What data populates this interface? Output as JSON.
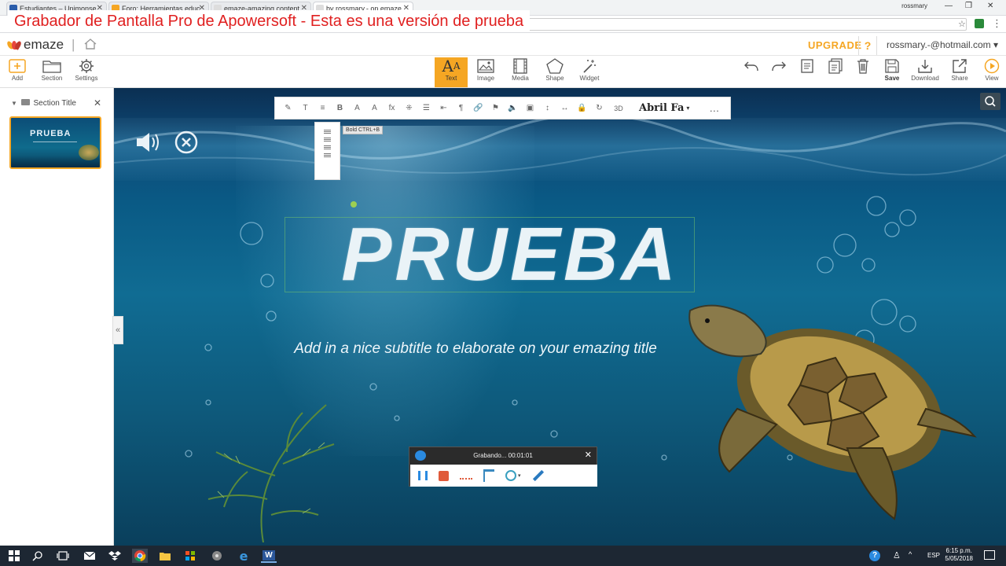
{
  "browser": {
    "tabs": [
      {
        "label": "Estudiantes – Unimonse",
        "favicon_color": "#2a5caa"
      },
      {
        "label": "Foro: Herramientas educ",
        "favicon_color": "#f5a623"
      },
      {
        "label": "emaze-amazing content",
        "favicon_color": "#dddddd"
      },
      {
        "label": "by rossmary.- on emaze",
        "favicon_color": "#dddddd"
      }
    ],
    "user_chip": "rossmary",
    "watermark": "Grabador de Pantalla Pro de Apowersoft - Esta es una versión de prueba"
  },
  "app": {
    "logo_text": "emaze",
    "upgrade_label": "UPGRADE",
    "help_label": "?",
    "account": "rossmary.-@hotmail.com ▾"
  },
  "toolbar": {
    "left": [
      {
        "label": "Add",
        "icon": "plus-box-icon"
      },
      {
        "label": "Section",
        "icon": "folder-icon"
      },
      {
        "label": "Settings",
        "icon": "gear-icon"
      }
    ],
    "center": [
      {
        "label": "Text",
        "icon": "text-aa-icon",
        "active": true
      },
      {
        "label": "Image",
        "icon": "image-icon"
      },
      {
        "label": "Media",
        "icon": "film-icon"
      },
      {
        "label": "Shape",
        "icon": "pentagon-icon"
      },
      {
        "label": "Widget",
        "icon": "wand-icon"
      }
    ],
    "right": [
      {
        "label": "",
        "icon": "undo-icon"
      },
      {
        "label": "",
        "icon": "redo-icon"
      },
      {
        "label": "",
        "icon": "notes-icon"
      },
      {
        "label": "",
        "icon": "duplicate-icon"
      },
      {
        "label": "",
        "icon": "trash-icon"
      },
      {
        "label": "Save",
        "icon": "save-icon"
      },
      {
        "label": "Download",
        "icon": "download-icon"
      },
      {
        "label": "Share",
        "icon": "share-icon"
      },
      {
        "label": "View",
        "icon": "play-icon"
      }
    ]
  },
  "panel": {
    "section_title": "Section Title",
    "thumb_title": "PRUEBA"
  },
  "format": {
    "buttons": [
      "✎",
      "T",
      "≡",
      "B",
      "A",
      "A",
      "fx",
      "⁜",
      "☰",
      "⇤",
      "¶",
      "🔗",
      "⚑",
      "🔈",
      "▣",
      "↕",
      "↔",
      "🔒",
      "↻",
      "3D"
    ],
    "font_name": "Abril Fa",
    "more": "…",
    "tooltip": "Bold CTRL+B"
  },
  "slide": {
    "title": "PRUEBA",
    "subtitle": "Add in a nice subtitle to elaborate on your emazing title"
  },
  "recorder": {
    "status": "Grabando... 00:01:01",
    "close": "✕"
  },
  "taskbar": {
    "language": "ESP",
    "time": "6:15 p.m.",
    "date": "5/05/2018"
  },
  "colors": {
    "accent": "#f5a623",
    "watermark": "#e02020",
    "water_deep": "#0b2f52"
  }
}
